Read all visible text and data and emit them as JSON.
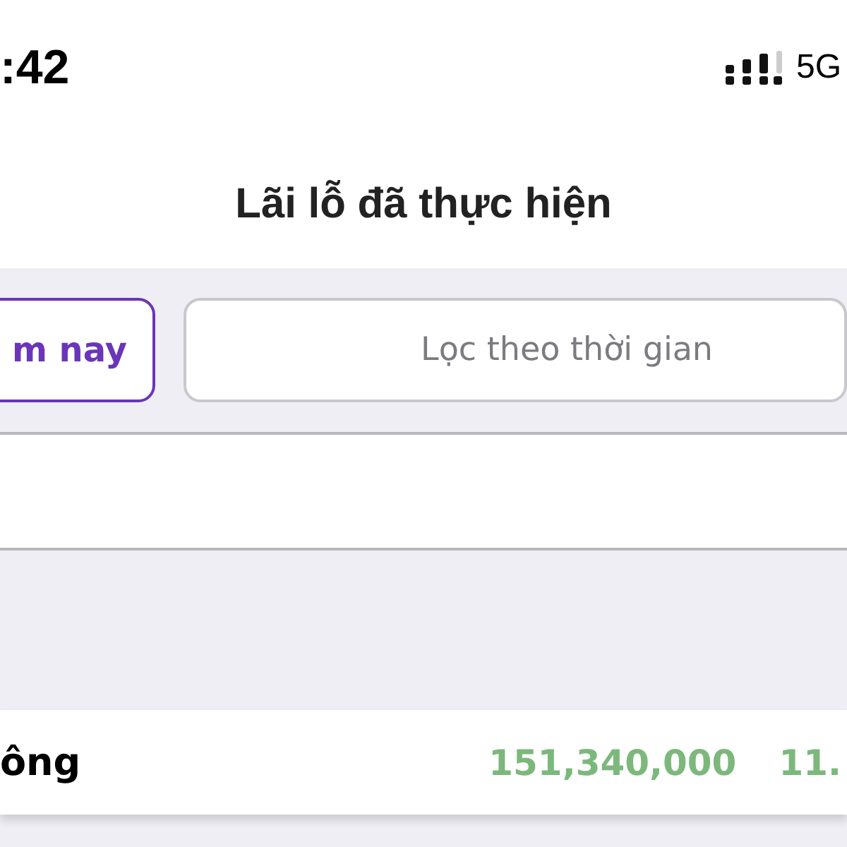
{
  "status_bar": {
    "time": ":42",
    "network": "5G"
  },
  "title": "Lãi lỗ đã thực hiện",
  "tabs": [
    {
      "label": "m nay",
      "selected": true
    }
  ],
  "filter": {
    "placeholder": "Lọc theo thời gian"
  },
  "summary_row": {
    "label": "ông",
    "values": [
      "151,340,000",
      "11."
    ]
  }
}
